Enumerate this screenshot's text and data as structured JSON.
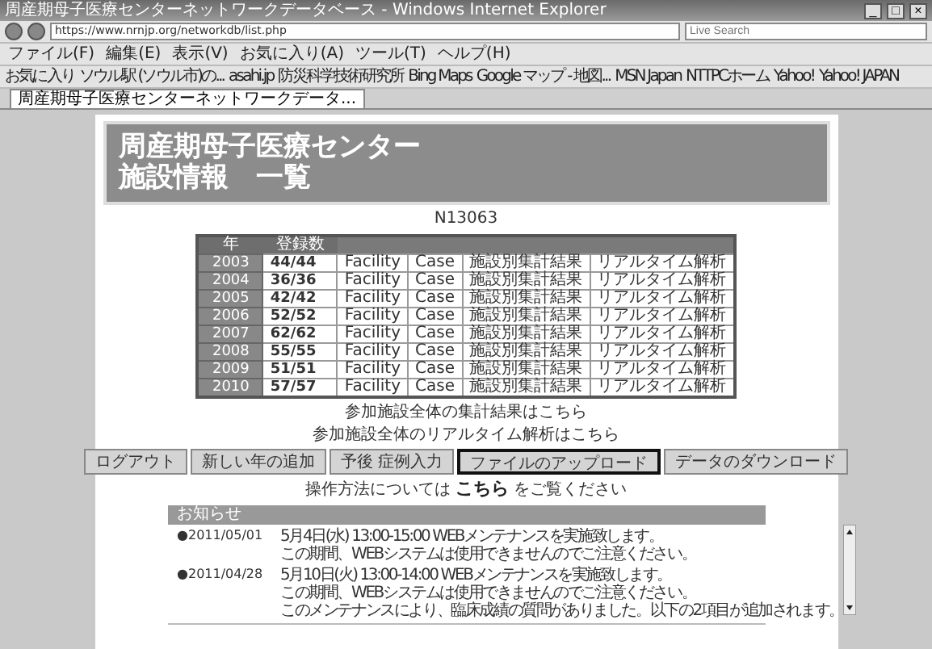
{
  "window": {
    "title": "周産期母子医療センターネットワークデータベース - Windows Internet Explorer",
    "controls": [
      "_",
      "□",
      "×"
    ]
  },
  "address_bar": {
    "url": "https://www.nrnjp.org/networkdb/list.php",
    "search_placeholder": "Live Search"
  },
  "menu": [
    "ファイル(F)",
    "編集(E)",
    "表示(V)",
    "お気に入り(A)",
    "ツール(T)",
    "ヘルプ(H)"
  ],
  "favorites": [
    "お気に入り",
    "ソウル駅 (ソウル市)の...",
    "asahi.jp",
    "防災科学技術研究所",
    "Bing Maps",
    "Google マップ - 地図...",
    "MSN Japan",
    "NTTPCホーム",
    "Yahoo!",
    "Yahoo! JAPAN"
  ],
  "tabs": [
    {
      "label": "周産期母子医療センターネットワークデータ...",
      "selected": true
    }
  ],
  "page": {
    "title_lines": [
      "周産期母子医療センター",
      "施設情報　一覧"
    ],
    "facility_id": "N13063",
    "table": {
      "columns": [
        "年",
        "登録数"
      ],
      "rows": [
        {
          "year": "2003",
          "count": "44/44",
          "cells": [
            "Facility",
            "Case",
            "施設別集計結果",
            "リアルタイム解析"
          ]
        },
        {
          "year": "2004",
          "count": "36/36",
          "cells": [
            "Facility",
            "Case",
            "施設別集計結果",
            "リアルタイム解析"
          ]
        },
        {
          "year": "2005",
          "count": "42/42",
          "cells": [
            "Facility",
            "Case",
            "施設別集計結果",
            "リアルタイム解析"
          ]
        },
        {
          "year": "2006",
          "count": "52/52",
          "cells": [
            "Facility",
            "Case",
            "施設別集計結果",
            "リアルタイム解析"
          ]
        },
        {
          "year": "2007",
          "count": "62/62",
          "cells": [
            "Facility",
            "Case",
            "施設別集計結果",
            "リアルタイム解析"
          ]
        },
        {
          "year": "2008",
          "count": "55/55",
          "cells": [
            "Facility",
            "Case",
            "施設別集計結果",
            "リアルタイム解析"
          ]
        },
        {
          "year": "2009",
          "count": "51/51",
          "cells": [
            "Facility",
            "Case",
            "施設別集計結果",
            "リアルタイム解析"
          ]
        },
        {
          "year": "2010",
          "count": "57/57",
          "cells": [
            "Facility",
            "Case",
            "施設別集計結果",
            "リアルタイム解析"
          ]
        }
      ]
    },
    "links": [
      "参加施設全体の集計結果はこちら",
      "参加施設全体のリアルタイム解析はこちら"
    ],
    "buttons": [
      {
        "label": "ログアウト",
        "selected": false
      },
      {
        "label": "新しい年の追加",
        "selected": false
      },
      {
        "label": "予後 症例入力",
        "selected": false
      },
      {
        "label": "ファイルのアップロード",
        "selected": true
      },
      {
        "label": "データのダウンロード",
        "selected": false
      }
    ],
    "help": {
      "before": "操作方法については",
      "link": "こちら",
      "after": "をご覧ください"
    },
    "news": {
      "title": "お知らせ",
      "items": [
        {
          "date": "●2011/05/01",
          "lines": [
            "5月4日(水) 13:00-15:00 WEBメンテナンスを実施致します。",
            "この期間、WEBシステムは使用できませんのでご注意ください。"
          ]
        },
        {
          "date": "●2011/04/28",
          "lines": [
            "5月10日(火) 13:00-14:00 WEBメンテナンスを実施致します。",
            "この期間、WEBシステムは使用できませんのでご注意ください。",
            "このメンテナンスにより、臨床成績の質問がありました。以下の2項目が追加されます。"
          ]
        }
      ]
    }
  }
}
